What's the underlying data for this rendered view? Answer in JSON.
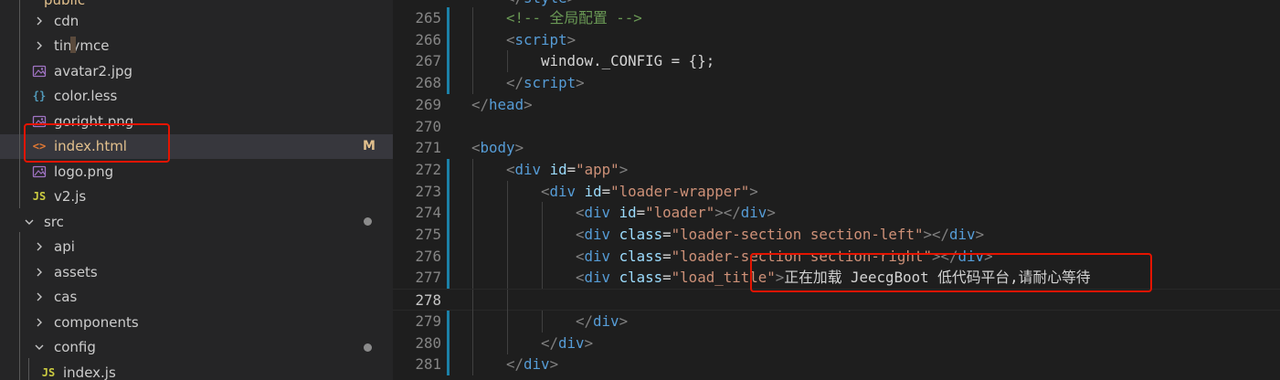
{
  "explorer": {
    "partial_folder_label": "public",
    "items": [
      {
        "name": "cdn",
        "type": "folder",
        "expanded": false,
        "level": 1
      },
      {
        "name": "tinymce",
        "type": "folder",
        "expanded": false,
        "level": 1
      },
      {
        "name": "avatar2.jpg",
        "type": "image",
        "icon": "image-file-icon",
        "level": 1
      },
      {
        "name": "color.less",
        "type": "less",
        "icon": "braces-file-icon",
        "icon_glyph": "{}",
        "level": 1
      },
      {
        "name": "goright.png",
        "type": "image",
        "icon": "image-file-icon",
        "level": 1
      },
      {
        "name": "index.html",
        "type": "html",
        "icon": "html-file-icon",
        "icon_glyph": "<>",
        "level": 1,
        "selected": true,
        "git_status": "M"
      },
      {
        "name": "logo.png",
        "type": "image",
        "icon": "image-file-icon",
        "level": 1
      },
      {
        "name": "v2.js",
        "type": "js",
        "icon": "js-file-icon",
        "icon_glyph": "JS",
        "level": 1
      },
      {
        "name": "src",
        "type": "folder",
        "expanded": true,
        "level": 0,
        "modified_dot": true
      },
      {
        "name": "api",
        "type": "folder",
        "expanded": false,
        "level": 1
      },
      {
        "name": "assets",
        "type": "folder",
        "expanded": false,
        "level": 1
      },
      {
        "name": "cas",
        "type": "folder",
        "expanded": false,
        "level": 1
      },
      {
        "name": "components",
        "type": "folder",
        "expanded": false,
        "level": 1
      },
      {
        "name": "config",
        "type": "folder",
        "expanded": true,
        "level": 1,
        "modified_dot": true
      },
      {
        "name": "index.js",
        "type": "js",
        "icon": "js-file-icon",
        "icon_glyph": "JS",
        "level": 2
      }
    ]
  },
  "editor": {
    "partial_top_line": [
      {
        "t": "punc",
        "v": "</"
      },
      {
        "t": "tag",
        "v": "style"
      },
      {
        "t": "punc",
        "v": ">"
      }
    ],
    "lines": [
      {
        "num": "265",
        "indent": 1,
        "modified": true,
        "tokens": [
          {
            "t": "comment",
            "v": "<!-- 全局配置 -->"
          }
        ]
      },
      {
        "num": "266",
        "indent": 1,
        "modified": true,
        "tokens": [
          {
            "t": "punc",
            "v": "<"
          },
          {
            "t": "tag",
            "v": "script"
          },
          {
            "t": "punc",
            "v": ">"
          }
        ]
      },
      {
        "num": "267",
        "indent": 2,
        "modified": true,
        "tokens": [
          {
            "t": "text",
            "v": "window._CONFIG = {};"
          }
        ]
      },
      {
        "num": "268",
        "indent": 1,
        "modified": true,
        "tokens": [
          {
            "t": "punc",
            "v": "</"
          },
          {
            "t": "tag",
            "v": "script"
          },
          {
            "t": "punc",
            "v": ">"
          }
        ]
      },
      {
        "num": "269",
        "indent": 0,
        "tokens": [
          {
            "t": "punc",
            "v": "</"
          },
          {
            "t": "tag",
            "v": "head"
          },
          {
            "t": "punc",
            "v": ">"
          }
        ]
      },
      {
        "num": "270",
        "indent": 0,
        "tokens": []
      },
      {
        "num": "271",
        "indent": 0,
        "tokens": [
          {
            "t": "punc",
            "v": "<"
          },
          {
            "t": "tag",
            "v": "body"
          },
          {
            "t": "punc",
            "v": ">"
          }
        ]
      },
      {
        "num": "272",
        "indent": 1,
        "modified": true,
        "tokens": [
          {
            "t": "punc",
            "v": "<"
          },
          {
            "t": "tag",
            "v": "div"
          },
          {
            "t": "text",
            "v": " "
          },
          {
            "t": "attr",
            "v": "id"
          },
          {
            "t": "text",
            "v": "="
          },
          {
            "t": "str",
            "v": "\"app\""
          },
          {
            "t": "punc",
            "v": ">"
          }
        ]
      },
      {
        "num": "273",
        "indent": 2,
        "modified": true,
        "tokens": [
          {
            "t": "punc",
            "v": "<"
          },
          {
            "t": "tag",
            "v": "div"
          },
          {
            "t": "text",
            "v": " "
          },
          {
            "t": "attr",
            "v": "id"
          },
          {
            "t": "text",
            "v": "="
          },
          {
            "t": "str",
            "v": "\"loader-wrapper\""
          },
          {
            "t": "punc",
            "v": ">"
          }
        ]
      },
      {
        "num": "274",
        "indent": 3,
        "modified": true,
        "tokens": [
          {
            "t": "punc",
            "v": "<"
          },
          {
            "t": "tag",
            "v": "div"
          },
          {
            "t": "text",
            "v": " "
          },
          {
            "t": "attr",
            "v": "id"
          },
          {
            "t": "text",
            "v": "="
          },
          {
            "t": "str",
            "v": "\"loader\""
          },
          {
            "t": "punc",
            "v": "></"
          },
          {
            "t": "tag",
            "v": "div"
          },
          {
            "t": "punc",
            "v": ">"
          }
        ]
      },
      {
        "num": "275",
        "indent": 3,
        "modified": true,
        "tokens": [
          {
            "t": "punc",
            "v": "<"
          },
          {
            "t": "tag",
            "v": "div"
          },
          {
            "t": "text",
            "v": " "
          },
          {
            "t": "attr",
            "v": "class"
          },
          {
            "t": "text",
            "v": "="
          },
          {
            "t": "str",
            "v": "\"loader-section section-left\""
          },
          {
            "t": "punc",
            "v": "></"
          },
          {
            "t": "tag",
            "v": "div"
          },
          {
            "t": "punc",
            "v": ">"
          }
        ]
      },
      {
        "num": "276",
        "indent": 3,
        "modified": true,
        "tokens": [
          {
            "t": "punc",
            "v": "<"
          },
          {
            "t": "tag",
            "v": "div"
          },
          {
            "t": "text",
            "v": " "
          },
          {
            "t": "attr",
            "v": "class"
          },
          {
            "t": "text",
            "v": "="
          },
          {
            "t": "str",
            "v": "\"loader-section section-right\""
          },
          {
            "t": "punc",
            "v": "></"
          },
          {
            "t": "tag",
            "v": "div"
          },
          {
            "t": "punc",
            "v": ">"
          }
        ]
      },
      {
        "num": "277",
        "indent": 3,
        "modified": true,
        "tokens": [
          {
            "t": "punc",
            "v": "<"
          },
          {
            "t": "tag",
            "v": "div"
          },
          {
            "t": "text",
            "v": " "
          },
          {
            "t": "attr",
            "v": "class"
          },
          {
            "t": "text",
            "v": "="
          },
          {
            "t": "str",
            "v": "\"load_title\""
          },
          {
            "t": "punc",
            "v": ">"
          },
          {
            "t": "text",
            "v": "正在加载 JeecgBoot 低代码平台,请耐心等待"
          }
        ]
      },
      {
        "num": "278",
        "indent": 2,
        "active": true,
        "current": true,
        "tokens": []
      },
      {
        "num": "279",
        "indent": 3,
        "modified": true,
        "tokens": [
          {
            "t": "punc",
            "v": "</"
          },
          {
            "t": "tag",
            "v": "div"
          },
          {
            "t": "punc",
            "v": ">"
          }
        ]
      },
      {
        "num": "280",
        "indent": 2,
        "modified": true,
        "tokens": [
          {
            "t": "punc",
            "v": "</"
          },
          {
            "t": "tag",
            "v": "div"
          },
          {
            "t": "punc",
            "v": ">"
          }
        ]
      },
      {
        "num": "281",
        "indent": 1,
        "modified": true,
        "tokens": [
          {
            "t": "punc",
            "v": "</"
          },
          {
            "t": "tag",
            "v": "div"
          },
          {
            "t": "punc",
            "v": ">"
          }
        ]
      }
    ]
  },
  "colors": {
    "tag": "#569cd6",
    "attr": "#9cdcfe",
    "string": "#ce9178",
    "comment": "#6a9955",
    "punc": "#808080",
    "text": "#d4d4d4",
    "git_modified": "#e2c08d",
    "gutter_modified": "#1b81a8",
    "highlight_box": "#e51400"
  }
}
